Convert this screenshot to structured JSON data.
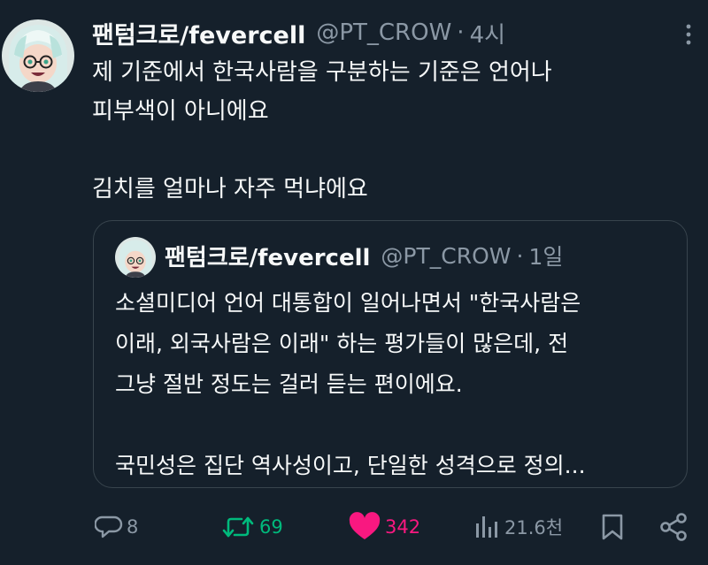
{
  "tweet": {
    "author": {
      "name": "팬텀크로/fevercell",
      "handle": "@PT_CROW",
      "time": "4시"
    },
    "separator": "·",
    "text_lines": [
      "제 기준에서 한국사람을 구분하는 기준은 언어나",
      "피부색이 아니에요",
      "",
      "김치를 얼마나 자주 먹냐에요"
    ]
  },
  "quote": {
    "author": {
      "name": "팬텀크로/fevercell",
      "handle": "@PT_CROW",
      "time": "1일"
    },
    "separator": "·",
    "text_lines": [
      "소셜미디어 언어 대통합이 일어나면서 \"한국사람은",
      "이래, 외국사람은 이래\" 하는 평가들이 많은데, 전",
      "그냥 절반 정도는 걸러 듣는 편이에요.",
      "",
      "국민성은 집단 역사성이고, 단일한 성격으로 정의..."
    ]
  },
  "actions": {
    "replies": "8",
    "retweets": "69",
    "likes": "342",
    "views": "21.6천"
  },
  "colors": {
    "background": "#15202b",
    "text": "#f7f9f9",
    "muted": "#8b98a5",
    "retweet_green": "#00ba7c",
    "like_pink": "#f91880",
    "border": "#38444d"
  },
  "icons": {
    "more": "more-vertical-icon",
    "reply": "reply-bubble-icon",
    "retweet": "retweet-icon",
    "like": "heart-filled-icon",
    "views": "views-bar-chart-icon",
    "bookmark": "bookmark-icon",
    "share": "share-icon"
  }
}
